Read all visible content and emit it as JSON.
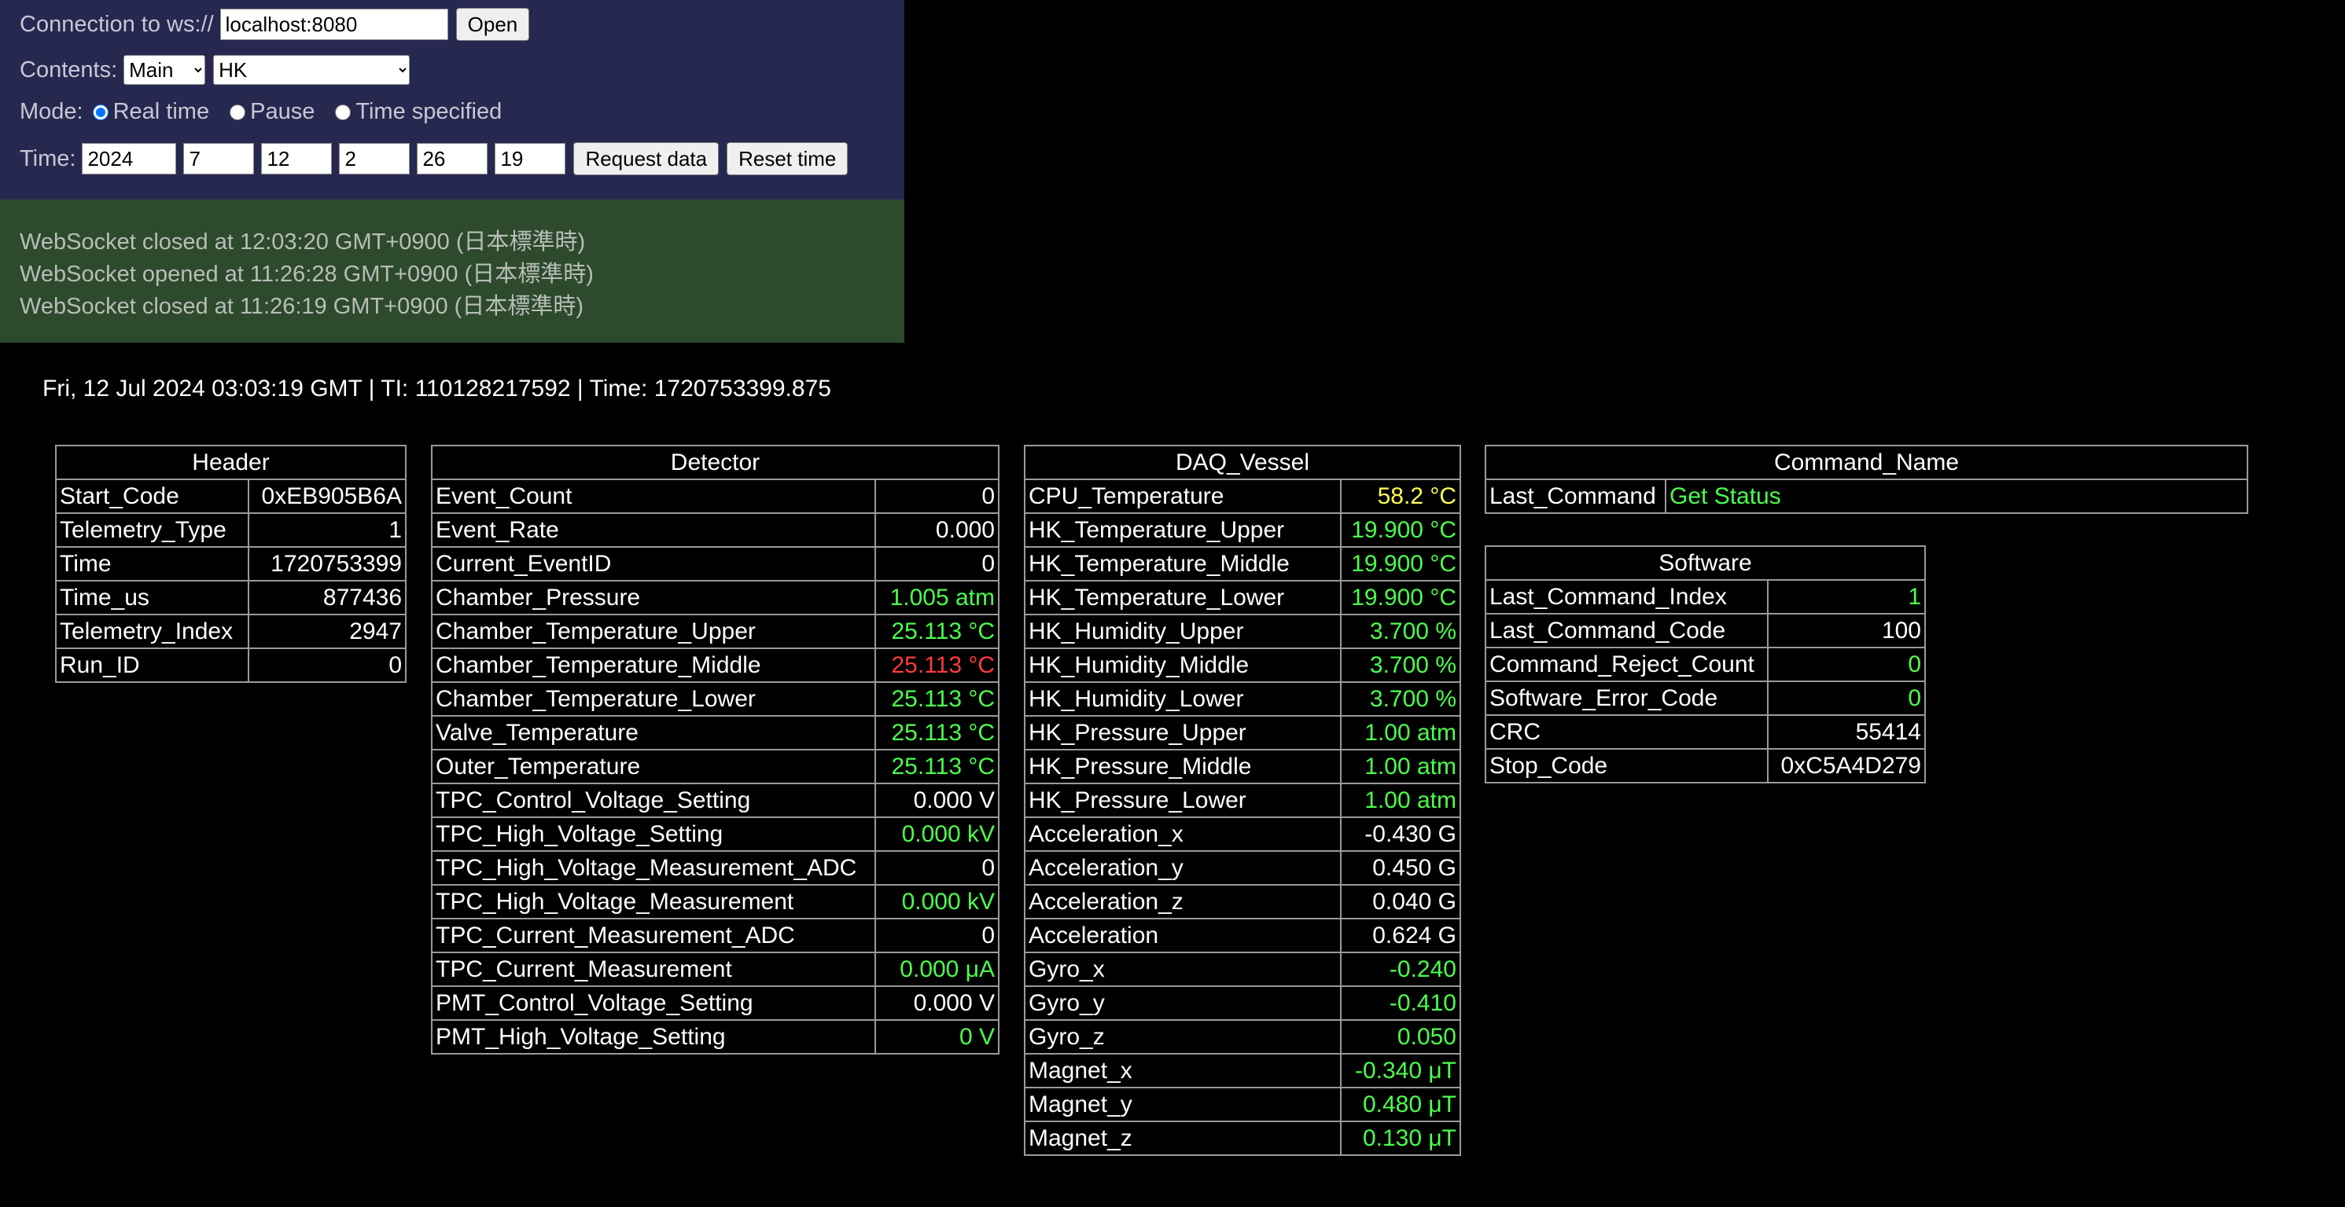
{
  "control": {
    "connection_label": "Connection to ws://",
    "host_value": "localhost:8080",
    "open_label": "Open",
    "contents_label": "Contents:",
    "contents_main": "Main",
    "contents_page": "HK",
    "mode_label": "Mode:",
    "mode_options": [
      "Real time",
      "Pause",
      "Time specified"
    ],
    "mode_selected": "Real time",
    "time_label": "Time:",
    "time_fields": [
      "2024",
      "7",
      "12",
      "2",
      "26",
      "19"
    ],
    "request_label": "Request data",
    "reset_label": "Reset time"
  },
  "log": [
    "WebSocket closed at 12:03:20 GMT+0900 (日本標準時)",
    "WebSocket opened at 11:26:28 GMT+0900 (日本標準時)",
    "WebSocket closed at 11:26:19 GMT+0900 (日本標準時)"
  ],
  "status_line": "Fri, 12 Jul 2024 03:03:19 GMT | TI: 110128217592 | Time: 1720753399.875",
  "colors": {
    "ok": "#4cff4c",
    "alert": "#ff3b3b",
    "warn": "#ffff55",
    "normal": "#ffffff"
  },
  "tables": {
    "header": {
      "title": "Header",
      "rows": [
        {
          "k": "Start_Code",
          "v": "0xEB905B6A",
          "c": "w"
        },
        {
          "k": "Telemetry_Type",
          "v": "1",
          "c": "w"
        },
        {
          "k": "Time",
          "v": "1720753399",
          "c": "w"
        },
        {
          "k": "Time_us",
          "v": "877436",
          "c": "w"
        },
        {
          "k": "Telemetry_Index",
          "v": "2947",
          "c": "w"
        },
        {
          "k": "Run_ID",
          "v": "0",
          "c": "w"
        }
      ]
    },
    "detector": {
      "title": "Detector",
      "rows": [
        {
          "k": "Event_Count",
          "v": "0",
          "c": "w"
        },
        {
          "k": "Event_Rate",
          "v": "0.000",
          "c": "w"
        },
        {
          "k": "Current_EventID",
          "v": "0",
          "c": "w"
        },
        {
          "k": "Chamber_Pressure",
          "v": "1.005 atm",
          "c": "g"
        },
        {
          "k": "Chamber_Temperature_Upper",
          "v": "25.113 °C",
          "c": "g"
        },
        {
          "k": "Chamber_Temperature_Middle",
          "v": "25.113 °C",
          "c": "r"
        },
        {
          "k": "Chamber_Temperature_Lower",
          "v": "25.113 °C",
          "c": "g"
        },
        {
          "k": "Valve_Temperature",
          "v": "25.113 °C",
          "c": "g"
        },
        {
          "k": "Outer_Temperature",
          "v": "25.113 °C",
          "c": "g"
        },
        {
          "k": "TPC_Control_Voltage_Setting",
          "v": "0.000 V",
          "c": "w"
        },
        {
          "k": "TPC_High_Voltage_Setting",
          "v": "0.000 kV",
          "c": "g"
        },
        {
          "k": "TPC_High_Voltage_Measurement_ADC",
          "v": "0",
          "c": "w"
        },
        {
          "k": "TPC_High_Voltage_Measurement",
          "v": "0.000 kV",
          "c": "g"
        },
        {
          "k": "TPC_Current_Measurement_ADC",
          "v": "0",
          "c": "w"
        },
        {
          "k": "TPC_Current_Measurement",
          "v": "0.000 μA",
          "c": "g"
        },
        {
          "k": "PMT_Control_Voltage_Setting",
          "v": "0.000 V",
          "c": "w"
        },
        {
          "k": "PMT_High_Voltage_Setting",
          "v": "0 V",
          "c": "g"
        }
      ]
    },
    "daq": {
      "title": "DAQ_Vessel",
      "rows": [
        {
          "k": "CPU_Temperature",
          "v": "58.2 °C",
          "c": "y"
        },
        {
          "k": "HK_Temperature_Upper",
          "v": "19.900 °C",
          "c": "g"
        },
        {
          "k": "HK_Temperature_Middle",
          "v": "19.900 °C",
          "c": "g"
        },
        {
          "k": "HK_Temperature_Lower",
          "v": "19.900 °C",
          "c": "g"
        },
        {
          "k": "HK_Humidity_Upper",
          "v": "3.700 %",
          "c": "g"
        },
        {
          "k": "HK_Humidity_Middle",
          "v": "3.700 %",
          "c": "g"
        },
        {
          "k": "HK_Humidity_Lower",
          "v": "3.700 %",
          "c": "g"
        },
        {
          "k": "HK_Pressure_Upper",
          "v": "1.00 atm",
          "c": "g"
        },
        {
          "k": "HK_Pressure_Middle",
          "v": "1.00 atm",
          "c": "g"
        },
        {
          "k": "HK_Pressure_Lower",
          "v": "1.00 atm",
          "c": "g"
        },
        {
          "k": "Acceleration_x",
          "v": "-0.430 G",
          "c": "w"
        },
        {
          "k": "Acceleration_y",
          "v": "0.450 G",
          "c": "w"
        },
        {
          "k": "Acceleration_z",
          "v": "0.040 G",
          "c": "w"
        },
        {
          "k": "Acceleration",
          "v": "0.624 G",
          "c": "w"
        },
        {
          "k": "Gyro_x",
          "v": "-0.240",
          "c": "g"
        },
        {
          "k": "Gyro_y",
          "v": "-0.410",
          "c": "g"
        },
        {
          "k": "Gyro_z",
          "v": "0.050",
          "c": "g"
        },
        {
          "k": "Magnet_x",
          "v": "-0.340 μT",
          "c": "g"
        },
        {
          "k": "Magnet_y",
          "v": "0.480 μT",
          "c": "g"
        },
        {
          "k": "Magnet_z",
          "v": "0.130 μT",
          "c": "g"
        }
      ]
    },
    "command": {
      "title": "Command_Name",
      "rows": [
        {
          "k": "Last_Command",
          "v": "Get Status",
          "c": "g"
        }
      ]
    },
    "software": {
      "title": "Software",
      "rows": [
        {
          "k": "Last_Command_Index",
          "v": "1",
          "c": "g"
        },
        {
          "k": "Last_Command_Code",
          "v": "100",
          "c": "w"
        },
        {
          "k": "Command_Reject_Count",
          "v": "0",
          "c": "g"
        },
        {
          "k": "Software_Error_Code",
          "v": "0",
          "c": "g"
        },
        {
          "k": "CRC",
          "v": "55414",
          "c": "w"
        },
        {
          "k": "Stop_Code",
          "v": "0xC5A4D279",
          "c": "w"
        }
      ]
    }
  }
}
